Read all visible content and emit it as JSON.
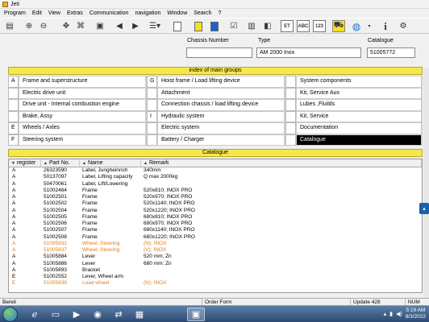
{
  "window": {
    "title": "Jeti"
  },
  "menu": [
    {
      "label": "Program"
    },
    {
      "label": "Edit"
    },
    {
      "label": "View"
    },
    {
      "label": "Extras"
    },
    {
      "label": "Communication"
    },
    {
      "label": "navigation"
    },
    {
      "label": "Window"
    },
    {
      "label": "Search"
    },
    {
      "label": "?"
    }
  ],
  "toolbar": {
    "et_label": "ET",
    "abc_label": "ABC",
    "num_label": "123",
    "info_label": "i"
  },
  "header": {
    "chassis_label": "Chassis Number",
    "chassis_value": "",
    "type_label": "Type",
    "type_value": "AM 2000 Inox",
    "catalogue_label": "Catalogue",
    "catalogue_value": "51005772"
  },
  "main_groups": {
    "title": "index of main groups",
    "rows": [
      [
        {
          "key": "A",
          "name": "Frame and superstructure"
        },
        {
          "key": "G",
          "name": "Hoist frame / Load lifting device"
        },
        {
          "key": "",
          "name": "System components"
        }
      ],
      [
        {
          "key": "",
          "name": "Electric drive unit"
        },
        {
          "key": "",
          "name": "Attachment"
        },
        {
          "key": "",
          "name": "Kit, Service Aux"
        }
      ],
      [
        {
          "key": "",
          "name": "Drive unit - Internal combustion engine"
        },
        {
          "key": "",
          "name": "Connection chassis / load lifting device"
        },
        {
          "key": "",
          "name": "Lubes ,Fluilds"
        }
      ],
      [
        {
          "key": "",
          "name": "Brake, Assy"
        },
        {
          "key": "I",
          "name": "Hydraulic system"
        },
        {
          "key": "",
          "name": "Kit, Service"
        }
      ],
      [
        {
          "key": "E",
          "name": "Wheels / Axles"
        },
        {
          "key": "",
          "name": "Electric system"
        },
        {
          "key": "",
          "name": "Documentation"
        }
      ],
      [
        {
          "key": "F",
          "name": "Steering system"
        },
        {
          "key": "",
          "name": "Battery / Charger"
        },
        {
          "key": "",
          "name": "Catalogue",
          "selected": true
        }
      ]
    ]
  },
  "catalogue": {
    "title": "Catalogue",
    "columns": [
      "register",
      "Part No.",
      "Name",
      "Remark"
    ],
    "rows": [
      {
        "reg": "A",
        "part": "26323590",
        "name": "Label, Jungheinrich",
        "remark": "340mm"
      },
      {
        "reg": "A",
        "part": "50137097",
        "name": "Label, Lifting capacity",
        "remark": "Q max 2000kg"
      },
      {
        "reg": "A",
        "part": "50470061",
        "name": "Label, Lift/Lowering",
        "remark": ""
      },
      {
        "reg": "A",
        "part": "51002464",
        "name": "Frame",
        "remark": "520x810; INOX PRO"
      },
      {
        "reg": "A",
        "part": "51002501",
        "name": "Frame",
        "remark": "520x970; INOX PRO"
      },
      {
        "reg": "A",
        "part": "51002502",
        "name": "Frame",
        "remark": "520x1140; INOX PRO"
      },
      {
        "reg": "A",
        "part": "51002504",
        "name": "Frame",
        "remark": "520x1220; INOX PRO"
      },
      {
        "reg": "A",
        "part": "51002505",
        "name": "Frame",
        "remark": "680x810; INOX PRO"
      },
      {
        "reg": "A",
        "part": "51002506",
        "name": "Frame",
        "remark": "680x970; INOX PRO"
      },
      {
        "reg": "A",
        "part": "51002507",
        "name": "Frame",
        "remark": "680x1140; INOX PRO"
      },
      {
        "reg": "A",
        "part": "51002508",
        "name": "Frame",
        "remark": "680x1220; INOX PRO"
      },
      {
        "reg": "A",
        "part": "51005832",
        "name": "Wheel, Steering",
        "remark": "(N); INOX",
        "orange": true
      },
      {
        "reg": "A",
        "part": "51005837",
        "name": "Wheel, Steering",
        "remark": "(V); INOX",
        "orange": true
      },
      {
        "reg": "A",
        "part": "51005884",
        "name": "Lever",
        "remark": "520 mm; Zn"
      },
      {
        "reg": "A",
        "part": "51005886",
        "name": "Lever",
        "remark": "680 mm; Zn"
      },
      {
        "reg": "A",
        "part": "51005893",
        "name": "Bracket",
        "remark": ""
      },
      {
        "reg": "E",
        "part": "51002552",
        "name": "Lever, Wheel arm",
        "remark": ""
      },
      {
        "reg": "E",
        "part": "51005839",
        "name": "Load wheel",
        "remark": "(N); INOX",
        "orange": true
      }
    ]
  },
  "status": {
    "left": "Bereit",
    "center": "Order Form",
    "update": "Update 428",
    "num": "NUM"
  },
  "taskbar": {
    "time": "5:19 AM",
    "date": "8/3/2022"
  },
  "colors": {
    "section_yellow": "#f7e84a",
    "orange_row": "#e08020",
    "selected_bg": "#000000"
  }
}
